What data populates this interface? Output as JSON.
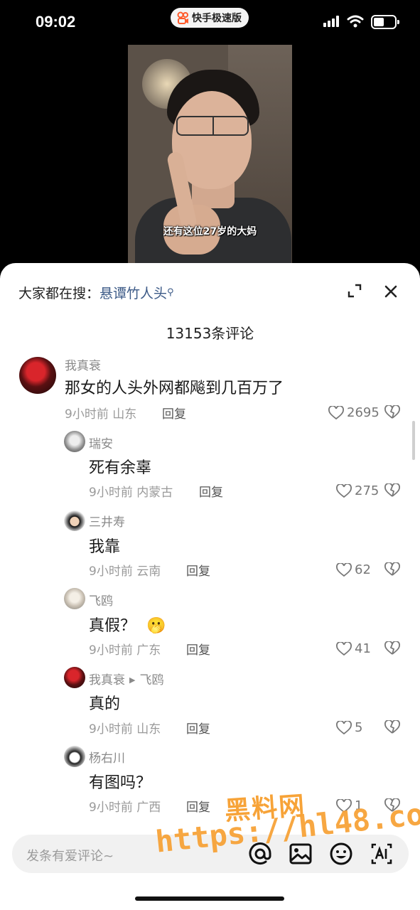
{
  "status_bar": {
    "time": "09:02",
    "app_name": "快手极速版"
  },
  "video": {
    "subtitle": "还有这位27岁的大妈"
  },
  "header": {
    "search_prefix": "大家都在搜：",
    "search_keyword": "悬谭竹人头",
    "comment_count_title": "13153条评论"
  },
  "comments": [
    {
      "user": "我真衰",
      "text": "那女的人头外网都飚到几百万了",
      "time_location": "9小时前 山东",
      "reply_label": "回复",
      "likes": "2695"
    },
    {
      "user": "瑞安",
      "text": "死有余辜",
      "time_location": "9小时前 内蒙古",
      "reply_label": "回复",
      "likes": "275"
    },
    {
      "user": "三井寿",
      "text": "我靠",
      "time_location": "9小时前 云南",
      "reply_label": "回复",
      "likes": "62"
    },
    {
      "user": "飞鸥",
      "text": "真假？",
      "emoji": "🫢",
      "time_location": "9小时前 广东",
      "reply_label": "回复",
      "likes": "41"
    },
    {
      "user": "我真衰",
      "reply_to": "飞鸥",
      "text": "真的",
      "time_location": "9小时前 山东",
      "reply_label": "回复",
      "likes": "5"
    },
    {
      "user": "杨右川",
      "text": "有图吗？",
      "time_location": "9小时前 广西",
      "reply_label": "回复",
      "likes": "1"
    }
  ],
  "input": {
    "placeholder": "发条有爱评论~"
  },
  "watermark": {
    "line1": "黑料网",
    "line2": "https://hl48.co"
  },
  "colors": {
    "accent_link": "#3c5a87",
    "watermark": "#f7a338"
  }
}
